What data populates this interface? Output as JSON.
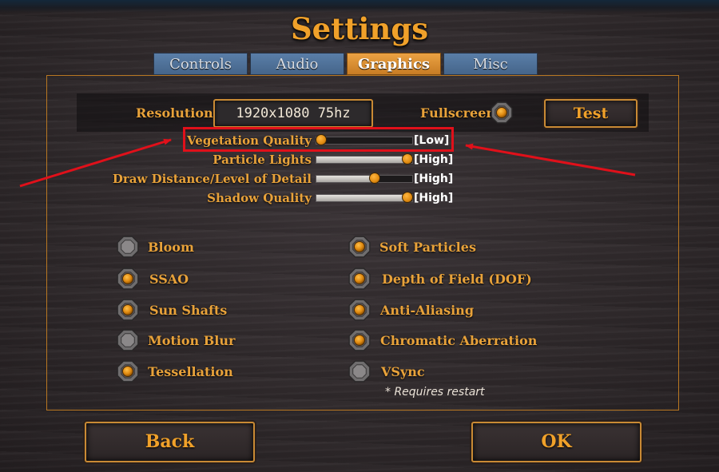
{
  "title": "Settings",
  "tabs": [
    {
      "label": "Controls",
      "active": false
    },
    {
      "label": "Audio",
      "active": false
    },
    {
      "label": "Graphics",
      "active": true
    },
    {
      "label": "Misc",
      "active": false
    }
  ],
  "resolution": {
    "label": "Resolution",
    "value": "1920x1080  75hz"
  },
  "fullscreen": {
    "label": "Fullscreen",
    "on": true
  },
  "test_button": "Test",
  "sliders": [
    {
      "label": "Vegetation Quality",
      "value_text": "[Low]",
      "level": 0.0
    },
    {
      "label": "Particle Lights",
      "value_text": "[High]",
      "level": 1.0
    },
    {
      "label": "Draw Distance/Level of Detail",
      "value_text": "[High]",
      "level": 0.62
    },
    {
      "label": "Shadow Quality",
      "value_text": "[High]",
      "level": 1.0
    }
  ],
  "options_left": [
    {
      "label": "Bloom",
      "on": false
    },
    {
      "label": "SSAO",
      "on": true
    },
    {
      "label": "Sun Shafts",
      "on": true
    },
    {
      "label": "Motion Blur",
      "on": false
    },
    {
      "label": "Tessellation",
      "on": true
    }
  ],
  "options_right": [
    {
      "label": "Soft Particles",
      "on": true
    },
    {
      "label": "Depth of Field (DOF)",
      "on": true
    },
    {
      "label": "Anti-Aliasing",
      "on": true
    },
    {
      "label": "Chromatic Aberration",
      "on": true
    },
    {
      "label": "VSync",
      "on": false
    }
  ],
  "restart_note": "* Requires restart",
  "back_button": "Back",
  "ok_button": "OK",
  "colors": {
    "accent": "#f0a12a",
    "tab": "#5a7ea8",
    "tab_active": "#e09a3e",
    "annotation": "#e0101a"
  }
}
